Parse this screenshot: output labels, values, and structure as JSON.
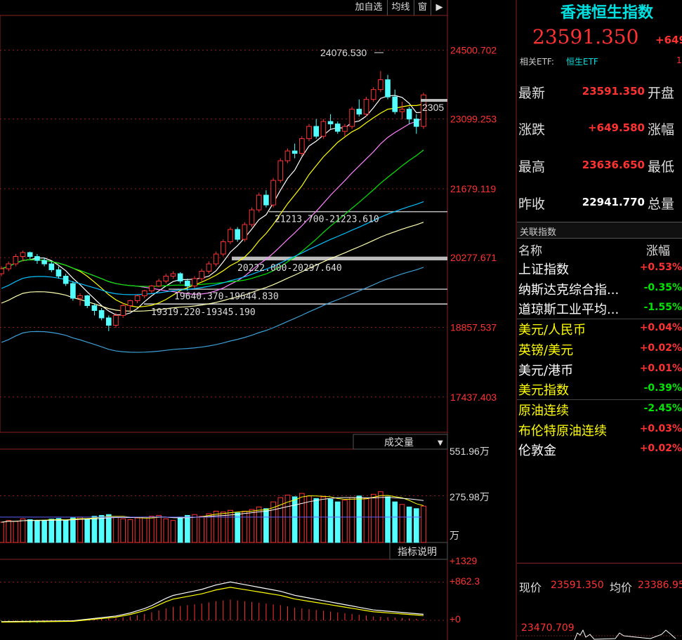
{
  "toolbar": {
    "add_watch": "加自选",
    "ma_line": "均线",
    "window": "窗",
    "window_icon": "play-icon"
  },
  "price_axis": [
    "24500.702",
    "23099.253",
    "21679.119",
    "20277.671",
    "18857.537",
    "17437.403"
  ],
  "price_axis_range": [
    16720,
    25210
  ],
  "annotations": {
    "high_label": "24076.530",
    "last_tag": "2305",
    "gap1": "21213.700-21223.610",
    "gap2": "20222.000-20297.640",
    "gap3": "19640.370-19644.830",
    "gap4": "19319.220-19345.190"
  },
  "volume": {
    "label": "成交量",
    "axis": [
      "551.96万",
      "275.98万",
      "万"
    ],
    "axis_range": [
      0,
      552
    ]
  },
  "indicator": {
    "label": "指标说明",
    "axis": [
      "+1329",
      "+862.3",
      "+0"
    ]
  },
  "index": {
    "title": "香港恒生指数",
    "price": "23591.350",
    "change": "+649"
  },
  "etf": {
    "label": "相关ETF:",
    "name": "恒生ETF",
    "extra": "1"
  },
  "quote": [
    {
      "label": "最新",
      "value": "23591.350",
      "label2": "开盘"
    },
    {
      "label": "涨跌",
      "value": "+649.580",
      "label2": "涨幅"
    },
    {
      "label": "最高",
      "value": "23636.650",
      "label2": "最低"
    },
    {
      "label": "昨收",
      "value": "22941.770",
      "label2": "总量"
    }
  ],
  "related": {
    "title": "关联指数",
    "col_name": "名称",
    "col_change": "涨幅",
    "items": [
      {
        "name": "上证指数",
        "change": "+0.53%"
      },
      {
        "name": "纳斯达克综合指...",
        "change": "-0.35%"
      },
      {
        "name": "道琼斯工业平均...",
        "change": "-1.55%"
      },
      {
        "name": "美元/人民币",
        "change": "+0.04%"
      },
      {
        "name": "英镑/美元",
        "change": "+0.02%"
      },
      {
        "name": "美元/港币",
        "change": "+0.01%"
      },
      {
        "name": "美元指数",
        "change": "-0.39%"
      },
      {
        "name": "原油连续",
        "change": "-2.45%"
      },
      {
        "name": "布伦特原油连续",
        "change": "+0.03%"
      },
      {
        "name": "伦敦金",
        "change": "+0.02%"
      }
    ]
  },
  "intraday": {
    "now_label": "现价",
    "now_value": "23591.350",
    "avg_label": "均价",
    "avg_value": "23386.95",
    "axis_value": "23470.709"
  },
  "colors": {
    "up": "#ff3232",
    "down": "#54ffff",
    "ma5": "#ffffff",
    "ma10": "#ffff00",
    "ma20": "#ff80ff",
    "ma30": "#00e600",
    "ma60": "#00c0ff",
    "ma120": "#ffffb0",
    "ma250": "#3d9fd6"
  },
  "chart_data": {
    "type": "candlestick",
    "candles": [
      [
        19950,
        20100,
        19900,
        20050
      ],
      [
        20050,
        20200,
        20000,
        20150
      ],
      [
        20150,
        20350,
        20100,
        20300
      ],
      [
        20300,
        20420,
        20200,
        20380
      ],
      [
        20380,
        20400,
        20250,
        20300
      ],
      [
        20300,
        20350,
        20150,
        20220
      ],
      [
        20220,
        20280,
        20100,
        20150
      ],
      [
        20150,
        20200,
        19980,
        20030
      ],
      [
        20030,
        20100,
        19850,
        19900
      ],
      [
        19900,
        19950,
        19700,
        19750
      ],
      [
        19750,
        19800,
        19400,
        19450
      ],
      [
        19450,
        19550,
        19300,
        19500
      ],
      [
        19500,
        19520,
        19250,
        19300
      ],
      [
        19300,
        19350,
        19100,
        19200
      ],
      [
        19200,
        19250,
        19000,
        19050
      ],
      [
        19050,
        19100,
        18780,
        18900
      ],
      [
        18900,
        19150,
        18850,
        19100
      ],
      [
        19100,
        19350,
        19050,
        19300
      ],
      [
        19300,
        19420,
        19200,
        19400
      ],
      [
        19400,
        19520,
        19350,
        19500
      ],
      [
        19500,
        19620,
        19450,
        19600
      ],
      [
        19600,
        19720,
        19550,
        19700
      ],
      [
        19700,
        19850,
        19680,
        19800
      ],
      [
        19800,
        19950,
        19750,
        19900
      ],
      [
        19900,
        20000,
        19850,
        19950
      ],
      [
        19950,
        19980,
        19750,
        19800
      ],
      [
        19800,
        19850,
        19600,
        19700
      ],
      [
        19700,
        19900,
        19650,
        19850
      ],
      [
        19850,
        20050,
        19800,
        20000
      ],
      [
        20000,
        20200,
        19950,
        20150
      ],
      [
        20150,
        20400,
        20100,
        20350
      ],
      [
        20350,
        20650,
        20300,
        20600
      ],
      [
        20600,
        20900,
        20550,
        20850
      ],
      [
        20850,
        20900,
        20600,
        20650
      ],
      [
        20650,
        21000,
        20600,
        20950
      ],
      [
        20950,
        21300,
        20900,
        21250
      ],
      [
        21250,
        21600,
        21200,
        21550
      ],
      [
        21550,
        21650,
        21300,
        21350
      ],
      [
        21350,
        21900,
        21300,
        21850
      ],
      [
        21850,
        22300,
        21800,
        22250
      ],
      [
        22250,
        22500,
        22200,
        22450
      ],
      [
        22450,
        22600,
        22300,
        22400
      ],
      [
        22400,
        22750,
        22350,
        22700
      ],
      [
        22700,
        23000,
        22650,
        22950
      ],
      [
        22950,
        23100,
        22700,
        22750
      ],
      [
        22750,
        23100,
        22700,
        23050
      ],
      [
        23050,
        23200,
        22900,
        23000
      ],
      [
        23000,
        23050,
        22800,
        22850
      ],
      [
        22850,
        23000,
        22750,
        22950
      ],
      [
        22950,
        23350,
        22900,
        23300
      ],
      [
        23300,
        23500,
        23150,
        23200
      ],
      [
        23200,
        23550,
        23150,
        23500
      ],
      [
        23500,
        23750,
        23450,
        23700
      ],
      [
        23700,
        24076,
        23650,
        23900
      ],
      [
        23900,
        24000,
        23500,
        23550
      ],
      [
        23550,
        23700,
        23200,
        23250
      ],
      [
        23250,
        23450,
        23100,
        23300
      ],
      [
        23300,
        23350,
        23000,
        23100
      ],
      [
        23100,
        23200,
        22800,
        22950
      ],
      [
        22950,
        23636,
        22900,
        23591
      ]
    ],
    "ma_periods": [
      5,
      10,
      20,
      30,
      60,
      120,
      250
    ],
    "volume": [
      120,
      130,
      125,
      140,
      135,
      128,
      132,
      138,
      142,
      130,
      145,
      150,
      140,
      155,
      160,
      165,
      150,
      140,
      135,
      145,
      150,
      155,
      160,
      140,
      130,
      150,
      160,
      165,
      155,
      170,
      185,
      180,
      190,
      175,
      185,
      195,
      210,
      200,
      240,
      265,
      280,
      270,
      290,
      275,
      260,
      270,
      255,
      240,
      250,
      265,
      275,
      260,
      285,
      300,
      270,
      240,
      225,
      210,
      200,
      215
    ],
    "indicator_hist": [
      -30,
      -40,
      -50,
      -60,
      -70,
      -80,
      -60,
      -40,
      -20,
      -10,
      0,
      10,
      20,
      30,
      40,
      50,
      60,
      80,
      100,
      130,
      160,
      200,
      250,
      300,
      340,
      360,
      380,
      400,
      420,
      450,
      480,
      500,
      520,
      500,
      480,
      460,
      440,
      420,
      400,
      380,
      350,
      320,
      300,
      280,
      260,
      240,
      220,
      200,
      180,
      160,
      140,
      120,
      100,
      90,
      80,
      70,
      60,
      50,
      40,
      30
    ],
    "indicator_range": [
      -200,
      1329
    ]
  }
}
